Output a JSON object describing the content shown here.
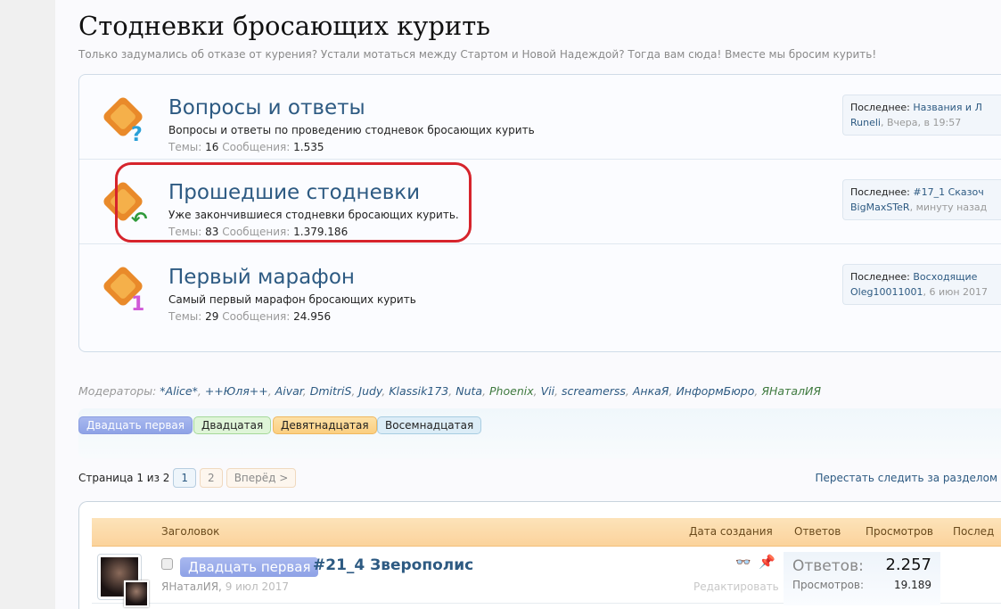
{
  "header": {
    "title": "Стодневки бросающих курить",
    "subtitle": "Только задумались об отказе от курения? Устали мотаться между Стартом и Новой Надеждой? Тогда вам сюда! Вместе мы бросим курить!"
  },
  "nodes": [
    {
      "title": "Вопросы и ответы",
      "desc": "Вопросы и ответы по проведению стодневок бросающих курить",
      "topics_label": "Темы:",
      "topics": "16",
      "msgs_label": "Сообщения:",
      "msgs": "1.535",
      "last_label": "Последнее:",
      "last_title": "Названия и Л",
      "last_user": "Runeli",
      "last_time": "Вчера, в 19:57",
      "badge": "?"
    },
    {
      "title": "Прошедшие стодневки",
      "desc": "Уже закончившиеся стодневки бросающих курить.",
      "topics_label": "Темы:",
      "topics": "83",
      "msgs_label": "Сообщения:",
      "msgs": "1.379.186",
      "last_label": "Последнее:",
      "last_title": "#17_1 Сказоч",
      "last_user": "BigMaxSTeR",
      "last_time": "минуту назад",
      "badge": "↶"
    },
    {
      "title": "Первый марафон",
      "desc": "Самый первый марафон бросающих курить",
      "topics_label": "Темы:",
      "topics": "29",
      "msgs_label": "Сообщения:",
      "msgs": "24.956",
      "last_label": "Последнее:",
      "last_title": "Восходящие",
      "last_user": "Oleg10011001",
      "last_time": "6 июн 2017",
      "badge": "1"
    }
  ],
  "moderators": {
    "label": "Модераторы:",
    "names": [
      {
        "name": "*Alice*",
        "color": "#2d5a82"
      },
      {
        "name": "++Юля++",
        "color": "#2d5a82"
      },
      {
        "name": "Aivar",
        "color": "#2d5a82"
      },
      {
        "name": "DmitriS",
        "color": "#2d5a82"
      },
      {
        "name": "Judy",
        "color": "#2d5a82"
      },
      {
        "name": "Klassik173",
        "color": "#2d5a82"
      },
      {
        "name": "Nuta",
        "color": "#2d5a82"
      },
      {
        "name": "Phoenix",
        "color": "#3f7a3f"
      },
      {
        "name": "Vii",
        "color": "#2d5a82"
      },
      {
        "name": "screamerss",
        "color": "#2d5a82"
      },
      {
        "name": "АнкаЯ",
        "color": "#2d5a82"
      },
      {
        "name": "ИнформБюро",
        "color": "#2d5a82"
      },
      {
        "name": "ЯНаталИЯ",
        "color": "#3f7a3f"
      }
    ]
  },
  "prefixes": [
    "Двадцать первая",
    "Двадцатая",
    "Девятнадцатая",
    "Восемнадцатая"
  ],
  "pager": {
    "label": "Страница 1 из 2",
    "pages": [
      "1",
      "2"
    ],
    "next": "Вперёд >"
  },
  "unwatch": "Перестать следить за разделом",
  "list": {
    "columns": [
      "Заголовок",
      "Дата создания",
      "Ответов",
      "Просмотров",
      "Послед"
    ],
    "threads": [
      {
        "prefix": "Двадцать первая",
        "title": "#21_4 Зверополис",
        "author": "ЯНаталИЯ",
        "date": "9 июл 2017",
        "edit": "Редактировать",
        "replies_label": "Ответов:",
        "replies": "2.257",
        "views_label": "Просмотров:",
        "views": "19.189"
      }
    ]
  }
}
